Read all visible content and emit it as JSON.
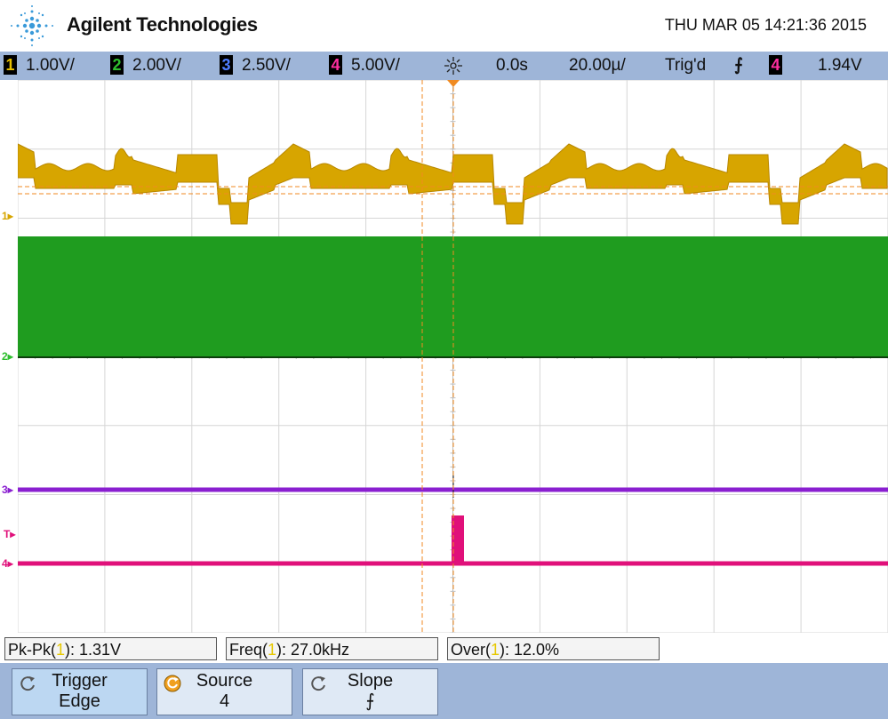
{
  "header": {
    "brand": "Agilent Technologies",
    "datetime": "THU MAR 05 14:21:36 2015"
  },
  "status": {
    "channels": [
      {
        "num": "1",
        "scale": "1.00V/",
        "color": "#e8c000"
      },
      {
        "num": "2",
        "scale": "2.00V/",
        "color": "#2fbf2f"
      },
      {
        "num": "3",
        "scale": "2.50V/",
        "color": "#4f7dff"
      },
      {
        "num": "4",
        "scale": "5.00V/",
        "color": "#ff2fa0"
      }
    ],
    "delay": "0.0s",
    "timebase": "20.00µ/",
    "trig_state": "Trig'd",
    "trig_slope_glyph": "⨍",
    "trig_source": "4",
    "trig_level": "1.94V"
  },
  "waveform_colors": {
    "ch1": "#d7a500",
    "ch2": "#1f9c1f",
    "ch3": "#8a1fd0",
    "ch4": "#e0107a"
  },
  "markers": {
    "ch1": "1",
    "ch2": "2",
    "ch3": "3",
    "trigger": "T",
    "ch4": "4"
  },
  "measurements": [
    {
      "label": "Pk-Pk(",
      "ch": "1",
      "rest": "): 1.31V"
    },
    {
      "label": "Freq(",
      "ch": "1",
      "rest": "): 27.0kHz"
    },
    {
      "label": "Over(",
      "ch": "1",
      "rest": "): 12.0%"
    }
  ],
  "softkeys": [
    {
      "line1": "Trigger",
      "line2": "Edge",
      "icon": "rotate-arrow-icon"
    },
    {
      "line1": "Source",
      "line2": "4",
      "icon": "entry-knob-icon"
    },
    {
      "line1": "Slope",
      "line2": "⨍",
      "icon": "rotate-arrow-icon"
    }
  ]
}
